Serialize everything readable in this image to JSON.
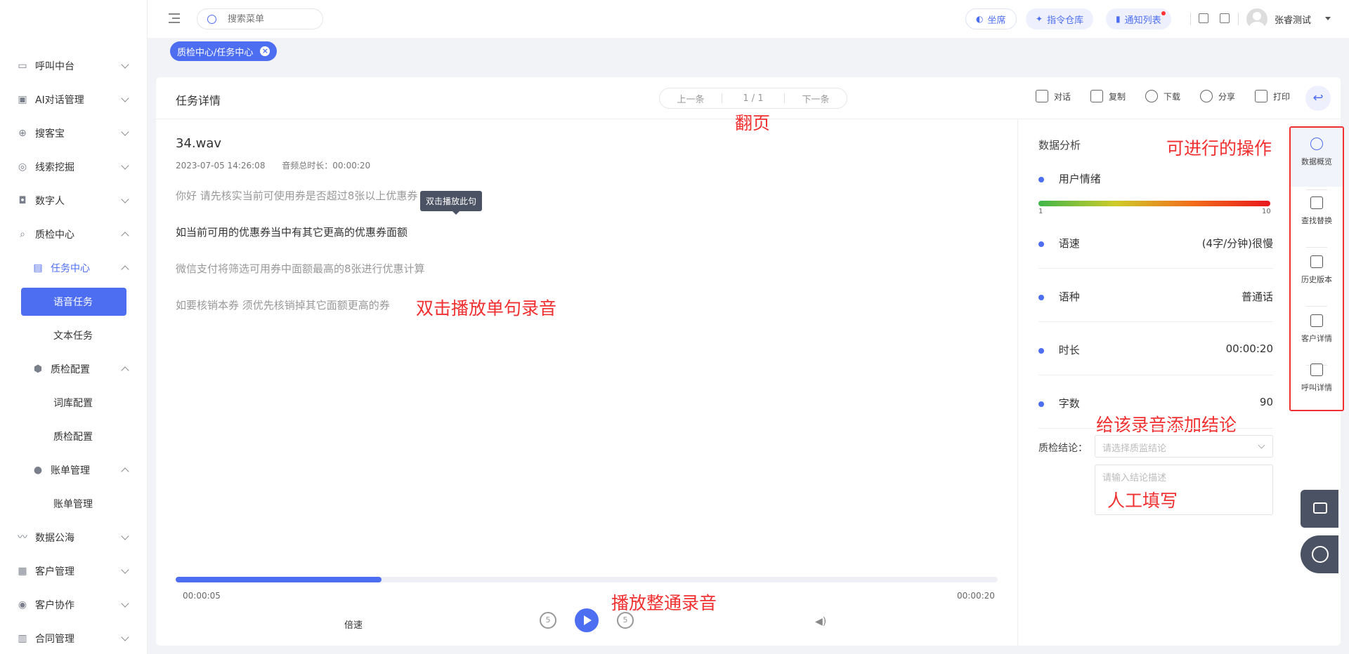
{
  "sidebar": {
    "items": [
      {
        "label": "呼叫中台",
        "icon": "monitor-icon"
      },
      {
        "label": "AI对话管理",
        "icon": "robot-icon"
      },
      {
        "label": "搜客宝",
        "icon": "search-plus-icon"
      },
      {
        "label": "线索挖掘",
        "icon": "target-icon"
      },
      {
        "label": "数字人",
        "icon": "person-card-icon"
      },
      {
        "label": "质检中心",
        "icon": "magnifier-icon"
      },
      {
        "label": "任务中心",
        "icon": "document-icon"
      },
      {
        "label": "语音任务"
      },
      {
        "label": "文本任务"
      },
      {
        "label": "质检配置",
        "icon": "hexagon-gear-icon"
      },
      {
        "label": "词库配置"
      },
      {
        "label": "质检配置"
      },
      {
        "label": "账单管理",
        "icon": "coin-icon"
      },
      {
        "label": "账单管理"
      },
      {
        "label": "数据公海",
        "icon": "chart-line-icon"
      },
      {
        "label": "客户管理",
        "icon": "users-icon"
      },
      {
        "label": "客户协作",
        "icon": "handshake-icon"
      },
      {
        "label": "合同管理",
        "icon": "contract-icon"
      }
    ]
  },
  "header": {
    "search_placeholder": "搜索菜单",
    "seat_label": "坐席",
    "cmd_label": "指令仓库",
    "notice_label": "通知列表",
    "username": "张睿测试"
  },
  "tabs": {
    "active": "质检中心/任务中心",
    "close": "×"
  },
  "task": {
    "title": "任务详情",
    "pager": {
      "prev": "上一条",
      "current": "1 / 1",
      "next": "下一条"
    },
    "toolbar": {
      "dialog": "对话",
      "copy": "复制",
      "download": "下载",
      "share": "分享",
      "print": "打印"
    },
    "file_name": "34.wav",
    "date": "2023-07-05 14:26:08",
    "duration_text": "音频总时长：00:00:20",
    "sentences": [
      "你好 请先核实当前可使用券是否超过8张以上优惠券",
      "如当前可用的优惠券当中有其它更高的优惠券面额",
      "微信支付将筛选可用券中面额最高的8张进行优惠计算",
      "如要核销本券 须优先核销掉其它面额更高的券"
    ],
    "tooltip": "双击播放此句",
    "player": {
      "current": "00:00:05",
      "total": "00:00:20",
      "progress_pct": 25,
      "speed_label": "倍速",
      "rewind": "5",
      "forward": "5"
    }
  },
  "analysis": {
    "title": "数据分析",
    "emotion_label": "用户情绪",
    "emotion_min": "1",
    "emotion_max": "10",
    "metrics": [
      {
        "label": "语速",
        "value": "(4字/分钟)很慢"
      },
      {
        "label": "语种",
        "value": "普通话"
      },
      {
        "label": "时长",
        "value": "00:00:20"
      },
      {
        "label": "字数",
        "value": "90"
      }
    ],
    "conclusion_label": "质检结论：",
    "conclusion_placeholder": "请选择质监结论",
    "desc_placeholder": "请输入结论描述"
  },
  "rail": {
    "items": [
      {
        "label": "数据概览",
        "icon": "loading-circle-icon"
      },
      {
        "label": "查找替换",
        "icon": "find-replace-icon"
      },
      {
        "label": "历史版本",
        "icon": "history-doc-icon"
      },
      {
        "label": "客户详情",
        "icon": "customer-card-icon"
      },
      {
        "label": "呼叫详情",
        "icon": "call-edit-icon"
      }
    ]
  },
  "annotations": {
    "paging": "翻页",
    "operations": "可进行的操作",
    "double_click": "双击播放单句录音",
    "add_conclusion": "给该录音添加结论",
    "manual_fill": "人工填写",
    "play_all": "播放整通录音"
  },
  "colors": {
    "accent": "#4e6ef2",
    "annotation": "#f03030"
  }
}
